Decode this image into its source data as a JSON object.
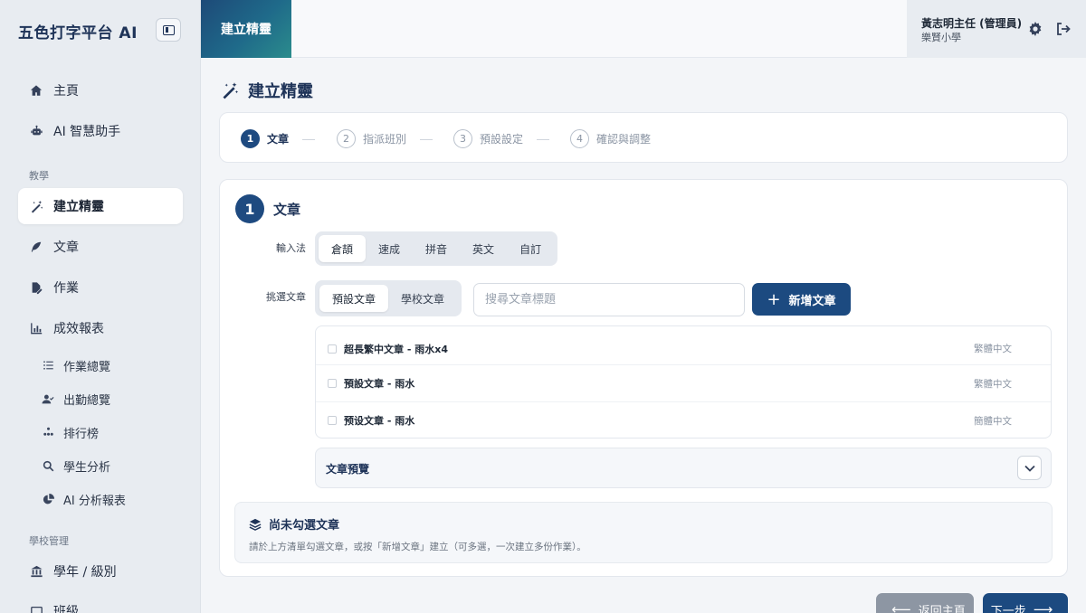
{
  "app": {
    "brand": "五色打字平台 AI"
  },
  "sidebar": {
    "items": [
      {
        "label": "主頁",
        "icon": "home-icon"
      },
      {
        "label": "AI 智慧助手",
        "icon": "robot-icon"
      }
    ],
    "section_teaching": "教學",
    "teaching_items": [
      {
        "label": "建立精靈",
        "icon": "magic-wand-icon",
        "active": true
      },
      {
        "label": "文章",
        "icon": "feather-icon"
      },
      {
        "label": "作業",
        "icon": "file-edit-icon"
      },
      {
        "label": "成效報表",
        "icon": "chart-icon"
      }
    ],
    "report_subitems": [
      {
        "label": "作業總覽",
        "icon": "list-icon"
      },
      {
        "label": "出勤總覽",
        "icon": "user-check-icon"
      },
      {
        "label": "排行榜",
        "icon": "ranking-icon"
      },
      {
        "label": "學生分析",
        "icon": "search-icon"
      },
      {
        "label": "AI 分析報表",
        "icon": "pie-chart-icon"
      }
    ],
    "section_school": "學校管理",
    "school_items": [
      {
        "label": "學年 / 級別",
        "icon": "building-icon"
      },
      {
        "label": "班級",
        "icon": "class-icon"
      }
    ]
  },
  "topbar": {
    "tab": "建立精靈",
    "user_name": "黃志明主任 (管理員)",
    "school": "樂賢小學"
  },
  "page": {
    "title": "建立精靈"
  },
  "steps": [
    {
      "num": "1",
      "label": "文章",
      "active": true
    },
    {
      "num": "2",
      "label": "指派班別"
    },
    {
      "num": "3",
      "label": "預設設定"
    },
    {
      "num": "4",
      "label": "確認與調整"
    }
  ],
  "card": {
    "num": "1",
    "title": "文章",
    "input_method_label": "輸入法",
    "input_methods": [
      "倉頡",
      "速成",
      "拼音",
      "英文",
      "自訂"
    ],
    "choose_label": "挑選文章",
    "sources": [
      "預設文章",
      "學校文章"
    ],
    "search_placeholder": "搜尋文章標題",
    "add_button": "新增文章",
    "articles": [
      {
        "title": "超長繁中文章 - 雨水x4",
        "lang": "繁體中文"
      },
      {
        "title": "預設文章 - 雨水",
        "lang": "繁體中文"
      },
      {
        "title": "预设文章 - 雨水",
        "lang": "簡體中文"
      }
    ],
    "preview_label": "文章預覽",
    "notice_title": "尚未勾選文章",
    "notice_body": "請於上方清單勾選文章，或按「新增文章」建立（可多選，一次建立多份作業）。"
  },
  "footer": {
    "back": "返回主頁",
    "next": "下一步"
  }
}
